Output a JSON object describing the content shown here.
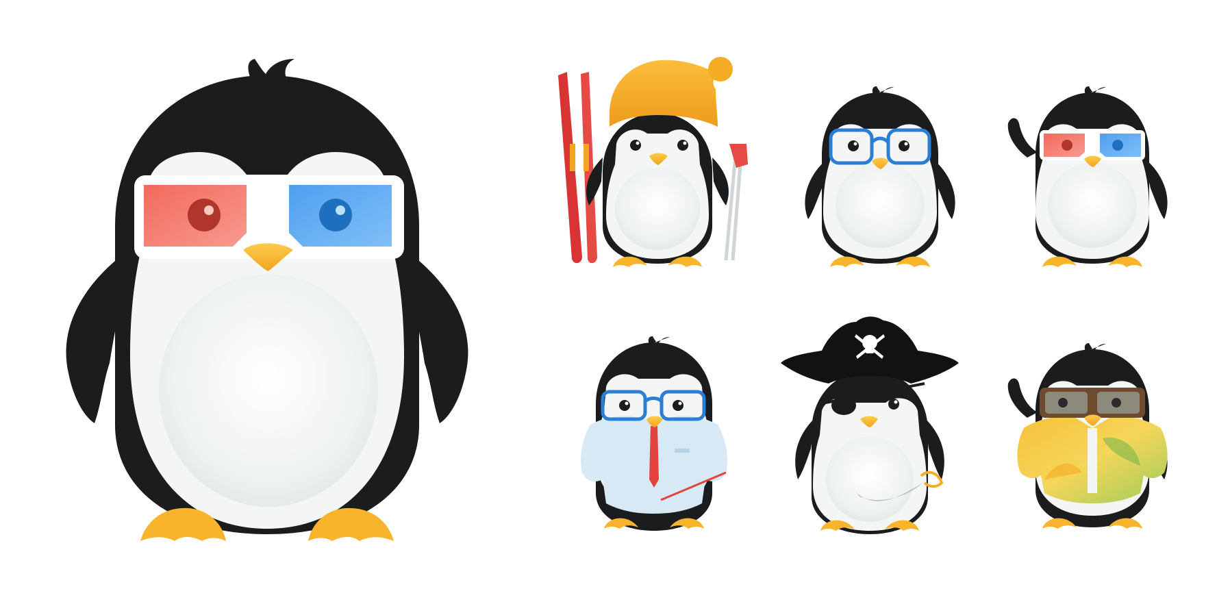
{
  "image": {
    "subject": "penguin-character-set",
    "background": "#ffffff"
  },
  "palette": {
    "body": "#1b1c1e",
    "belly": "#f2f4f4",
    "belly_shade": "#dde3e4",
    "beak": "#f7b731",
    "feet": "#f8b42d",
    "glasses_red": "#f57366",
    "glasses_blue": "#5aa9f2",
    "hat_yellow": "#f4ac24",
    "skis_red": "#d83434",
    "doctor_coat": "#d6e9f5",
    "tie_red": "#e2433d",
    "pirate_black": "#111214",
    "shirt_yellow": "#f6c543",
    "shirt_green": "#8cc152",
    "goggle_brown": "#6e4a2e"
  },
  "characters": [
    {
      "role": "large-3d-glasses-penguin",
      "accessory": "3d-glasses"
    },
    {
      "role": "skier-penguin",
      "accessory": "beanie-hat-and-skis"
    },
    {
      "role": "nerd-penguin",
      "accessory": "blue-glasses"
    },
    {
      "role": "waving-3d-glasses-penguin",
      "accessory": "3d-glasses"
    },
    {
      "role": "doctor-penguin",
      "accessory": "lab-coat-and-pointer"
    },
    {
      "role": "pirate-penguin",
      "accessory": "pirate-hat-eyepatch-sword"
    },
    {
      "role": "tourist-penguin",
      "accessory": "hawaiian-shirt-and-goggles"
    }
  ]
}
